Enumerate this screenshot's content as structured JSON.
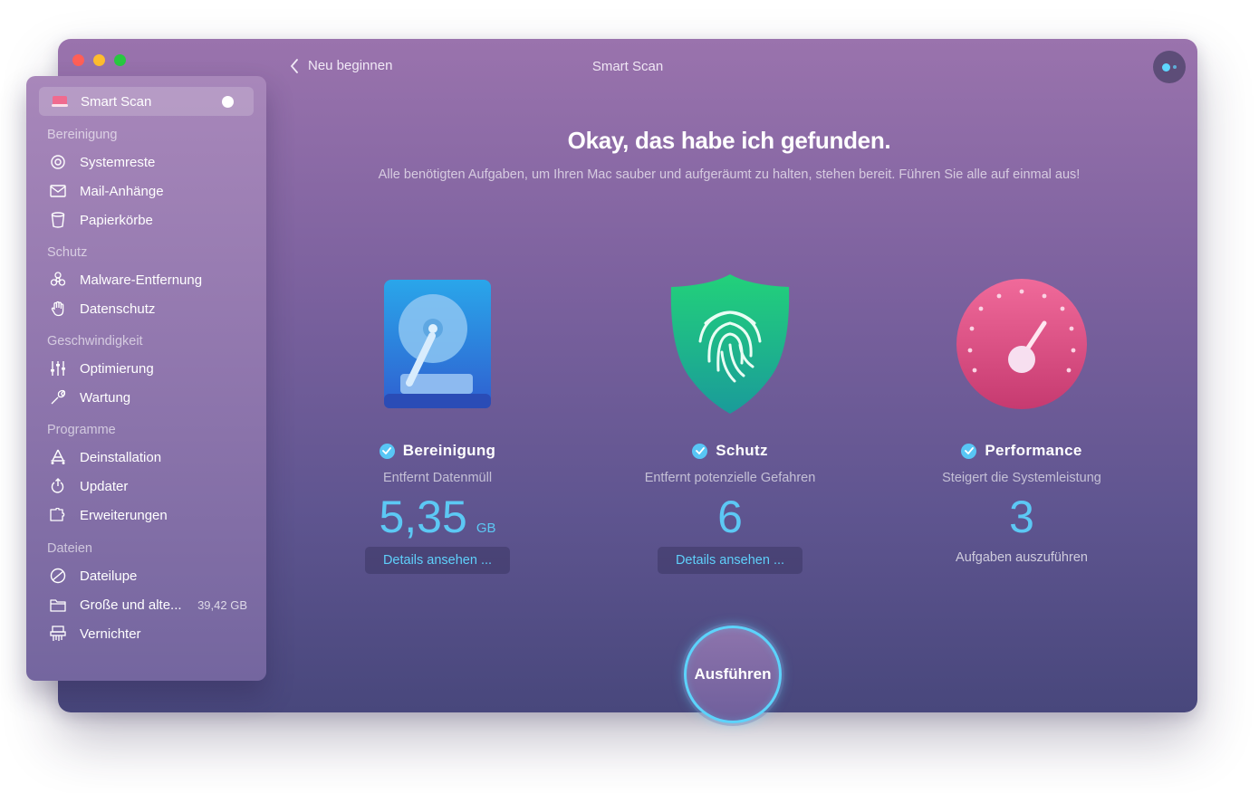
{
  "window": {
    "title": "Smart Scan",
    "back_label": "Neu beginnen"
  },
  "sidebar": {
    "smart_scan": "Smart Scan",
    "sections": {
      "cleanup": "Bereinigung",
      "protection": "Schutz",
      "speed": "Geschwindigkeit",
      "apps": "Programme",
      "files": "Dateien"
    },
    "items": {
      "systemreste": "Systemreste",
      "mail": "Mail-Anhänge",
      "papierkoerbe": "Papierkörbe",
      "malware": "Malware-Entfernung",
      "datenschutz": "Datenschutz",
      "optimierung": "Optimierung",
      "wartung": "Wartung",
      "deinstallation": "Deinstallation",
      "updater": "Updater",
      "erweiterungen": "Erweiterungen",
      "dateilupe": "Dateilupe",
      "grosse": "Große und alte...",
      "grosse_size": "39,42 GB",
      "vernichter": "Vernichter"
    }
  },
  "main": {
    "headline": "Okay, das habe ich gefunden.",
    "subline": "Alle benötigten Aufgaben, um Ihren Mac sauber und aufgeräumt zu halten, stehen bereit. Führen Sie alle auf einmal aus!",
    "cards": {
      "cleanup": {
        "title": "Bereinigung",
        "desc": "Entfernt Datenmüll",
        "value": "5,35",
        "unit": "GB",
        "button": "Details ansehen ..."
      },
      "protection": {
        "title": "Schutz",
        "desc": "Entfernt potenzielle Gefahren",
        "value": "6",
        "button": "Details ansehen ..."
      },
      "performance": {
        "title": "Performance",
        "desc": "Steigert die Systemleistung",
        "value": "3",
        "tasks_label": "Aufgaben auszuführen"
      }
    },
    "run_button": "Ausführen"
  },
  "colors": {
    "accent": "#5cc8f4",
    "close": "#ff5f57",
    "minimize": "#febc2e",
    "zoom": "#28c840"
  }
}
